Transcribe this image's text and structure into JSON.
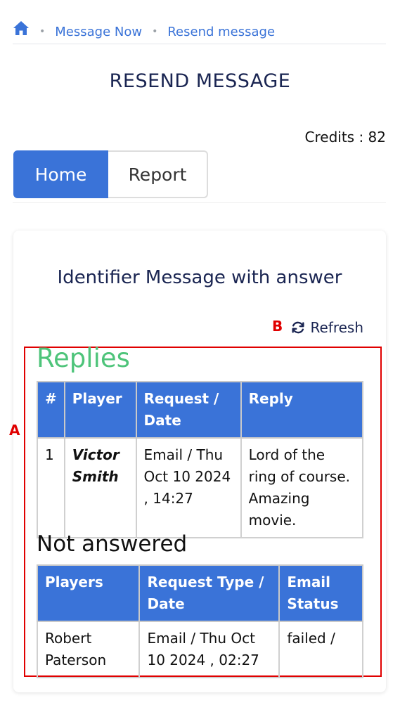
{
  "breadcrumb": {
    "icon": "home-icon",
    "items": [
      "Message Now",
      "Resend message"
    ]
  },
  "page_title": "RESEND MESSAGE",
  "credits": "Credits : 82",
  "tabs": [
    {
      "label": "Home",
      "active": true
    },
    {
      "label": "Report",
      "active": false
    }
  ],
  "card": {
    "title": "Identifier Message with answer",
    "refresh_label": "Refresh",
    "refresh_icon": "refresh-icon",
    "replies": {
      "title": "Replies",
      "columns": [
        "#",
        "Player",
        "Request / Date",
        "Reply"
      ],
      "rows": [
        {
          "num": "1",
          "player": "Victor Smith",
          "request_date": "Email / Thu Oct 10 2024 , 14:27",
          "reply": "Lord of the ring of course. Amazing movie."
        }
      ]
    },
    "not_answered": {
      "title": "Not answered",
      "columns": [
        "Players",
        "Request Type / Date",
        "Email Status"
      ],
      "rows": [
        {
          "player": "Robert Paterson",
          "request_date": "Email / Thu Oct 10 2024 , 02:27",
          "status": "failed /"
        }
      ]
    }
  },
  "annotations": {
    "marker_a": "A",
    "marker_b": "B"
  },
  "colors": {
    "primary": "#3a73d8",
    "title_navy": "#1a2552",
    "replies_green": "#4ec47a",
    "annotation_red": "#e00000"
  }
}
